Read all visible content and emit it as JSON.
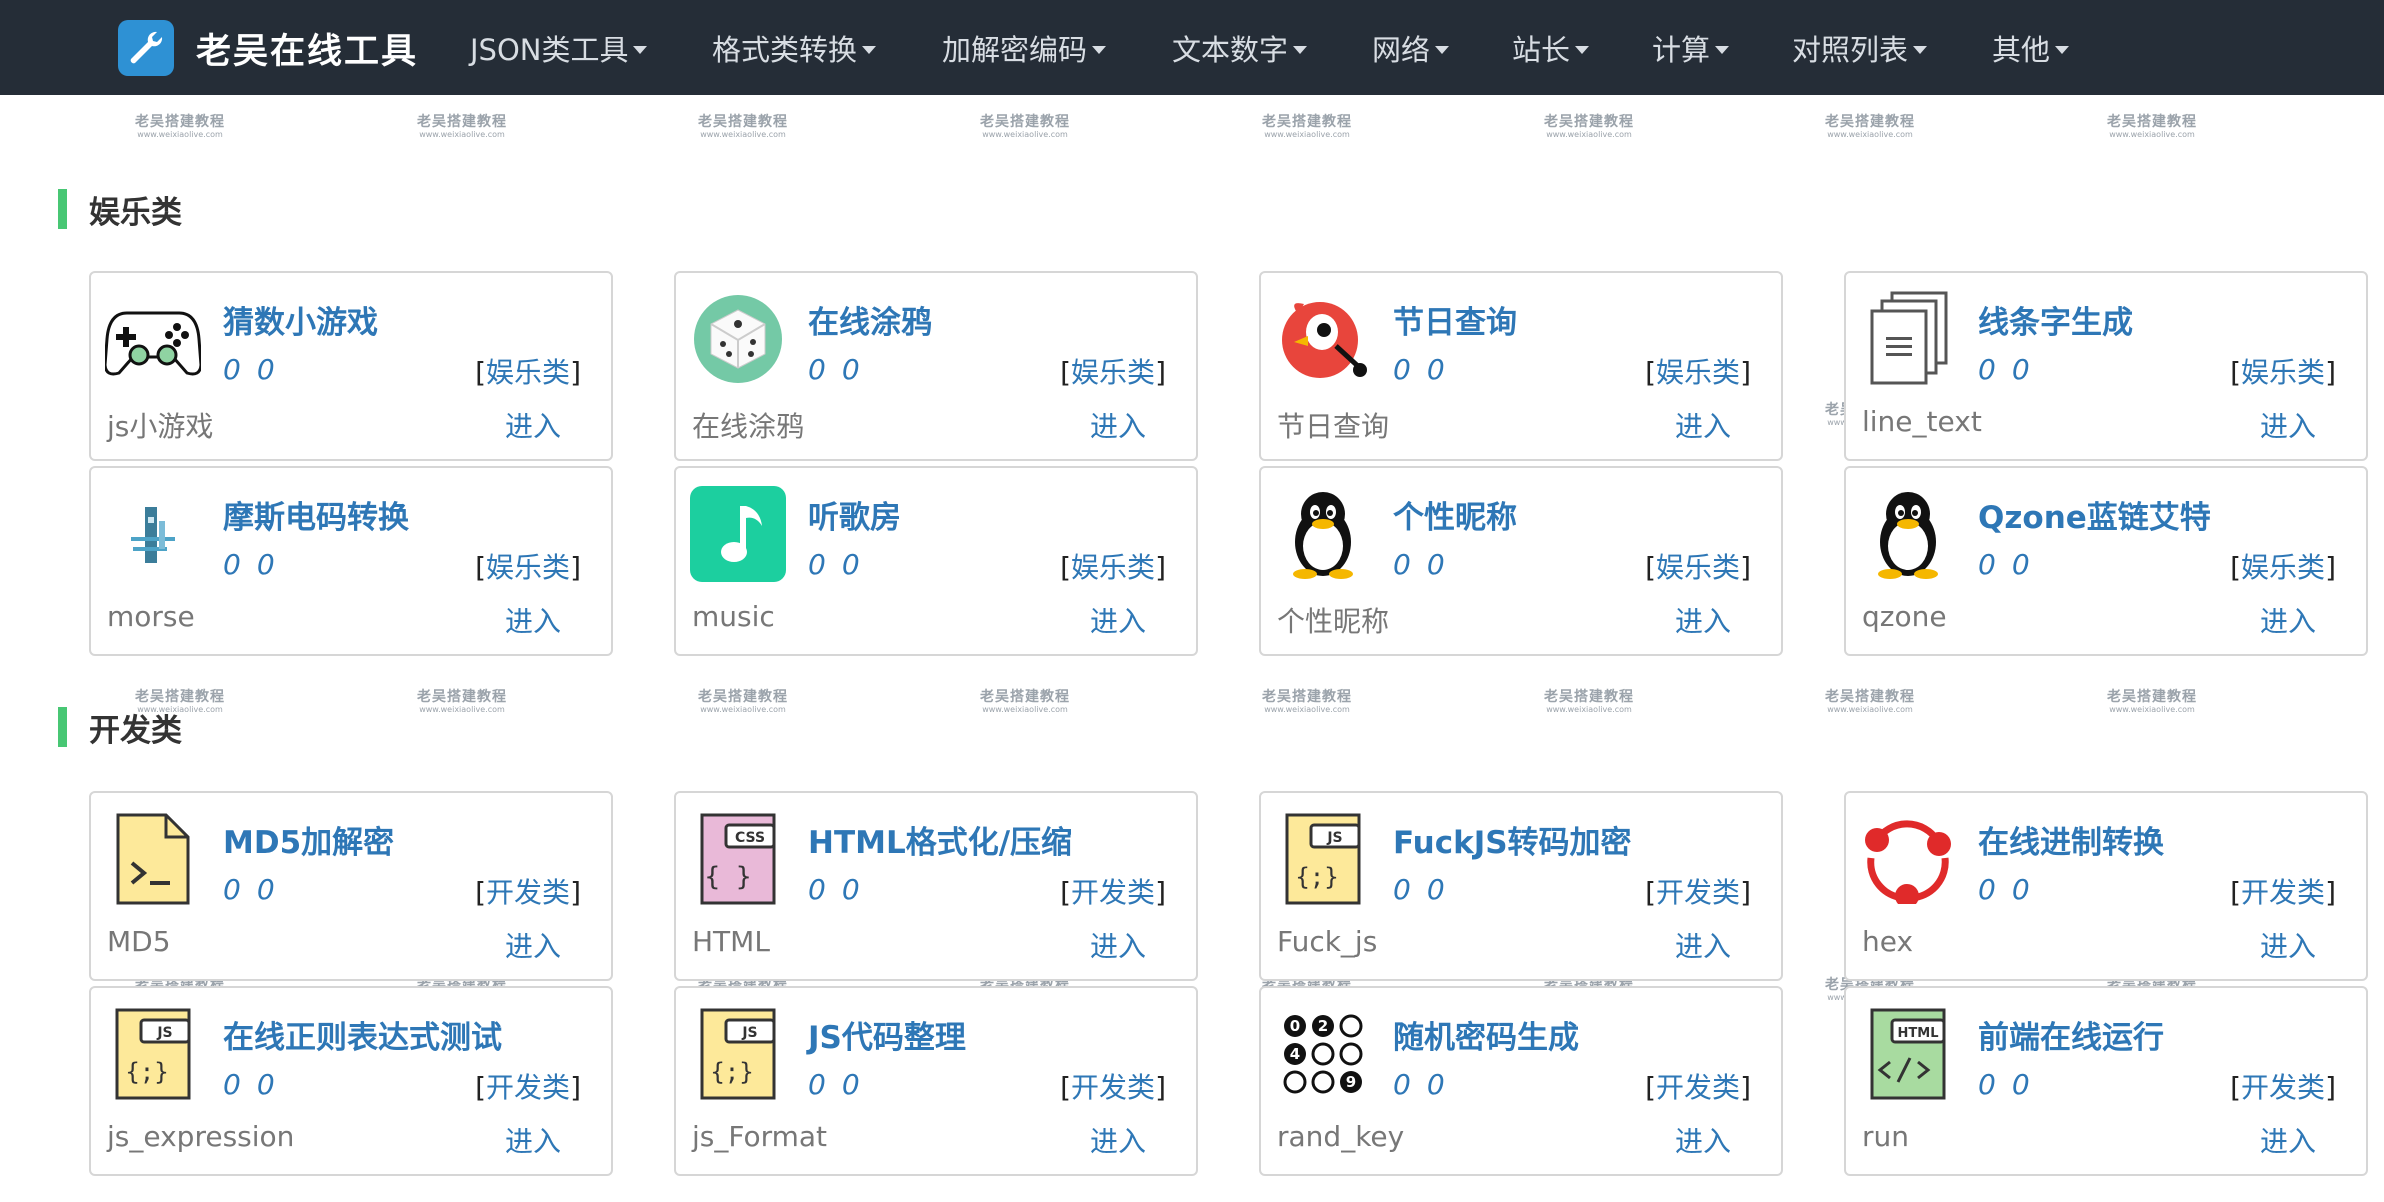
{
  "brand": {
    "name": "老吴在线工具"
  },
  "nav": [
    {
      "label": "JSON类工具"
    },
    {
      "label": "格式类转换"
    },
    {
      "label": "加解密编码"
    },
    {
      "label": "文本数字"
    },
    {
      "label": "网络"
    },
    {
      "label": "站长"
    },
    {
      "label": "计算"
    },
    {
      "label": "对照列表"
    },
    {
      "label": "其他"
    }
  ],
  "watermark": {
    "line1": "老吴搭建教程",
    "line2": "www.weixiaolive.com"
  },
  "colors": {
    "navbar": "#252d37",
    "accent": "#48c774",
    "link": "#2e77b6",
    "logo": "#2e91d4"
  },
  "enter_label": "进入",
  "sections": [
    {
      "title": "娱乐类",
      "cards": [
        {
          "title": "猜数小游戏",
          "stat1": "0",
          "stat2": "0",
          "category": "娱乐类",
          "sub": "js小游戏",
          "icon": "gamepad-icon"
        },
        {
          "title": "在线涂鸦",
          "stat1": "0",
          "stat2": "0",
          "category": "娱乐类",
          "sub": "在线涂鸦",
          "icon": "dice-icon"
        },
        {
          "title": "节日查询",
          "stat1": "0",
          "stat2": "0",
          "category": "娱乐类",
          "sub": "节日查询",
          "icon": "bird-icon"
        },
        {
          "title": "线条字生成",
          "stat1": "0",
          "stat2": "0",
          "category": "娱乐类",
          "sub": "line_text",
          "icon": "documents-icon"
        },
        {
          "title": "摩斯电码转换",
          "stat1": "0",
          "stat2": "0",
          "category": "娱乐类",
          "sub": "morse",
          "icon": "morse-icon"
        },
        {
          "title": "听歌房",
          "stat1": "0",
          "stat2": "0",
          "category": "娱乐类",
          "sub": "music",
          "icon": "music-note-icon"
        },
        {
          "title": "个性昵称",
          "stat1": "0",
          "stat2": "0",
          "category": "娱乐类",
          "sub": "个性昵称",
          "icon": "penguin-icon"
        },
        {
          "title": "Qzone蓝链艾特",
          "stat1": "0",
          "stat2": "0",
          "category": "娱乐类",
          "sub": "qzone",
          "icon": "penguin-icon"
        }
      ]
    },
    {
      "title": "开发类",
      "cards": [
        {
          "title": "MD5加解密",
          "stat1": "0",
          "stat2": "0",
          "category": "开发类",
          "sub": "MD5",
          "icon": "terminal-file-icon"
        },
        {
          "title": "HTML格式化/压缩",
          "stat1": "0",
          "stat2": "0",
          "category": "开发类",
          "sub": "HTML",
          "icon": "css-file-icon"
        },
        {
          "title": "FuckJS转码加密",
          "stat1": "0",
          "stat2": "0",
          "category": "开发类",
          "sub": "Fuck_js",
          "icon": "js-file-icon"
        },
        {
          "title": "在线进制转换",
          "stat1": "0",
          "stat2": "0",
          "category": "开发类",
          "sub": "hex",
          "icon": "network-nodes-icon"
        },
        {
          "title": "在线正则表达式测试",
          "stat1": "0",
          "stat2": "0",
          "category": "开发类",
          "sub": "js_expression",
          "icon": "js-file-icon"
        },
        {
          "title": "JS代码整理",
          "stat1": "0",
          "stat2": "0",
          "category": "开发类",
          "sub": "js_Format",
          "icon": "js-file-icon"
        },
        {
          "title": "随机密码生成",
          "stat1": "0",
          "stat2": "0",
          "category": "开发类",
          "sub": "rand_key",
          "icon": "number-dots-icon"
        },
        {
          "title": "前端在线运行",
          "stat1": "0",
          "stat2": "0",
          "category": "开发类",
          "sub": "run",
          "icon": "html-file-icon"
        }
      ]
    }
  ]
}
